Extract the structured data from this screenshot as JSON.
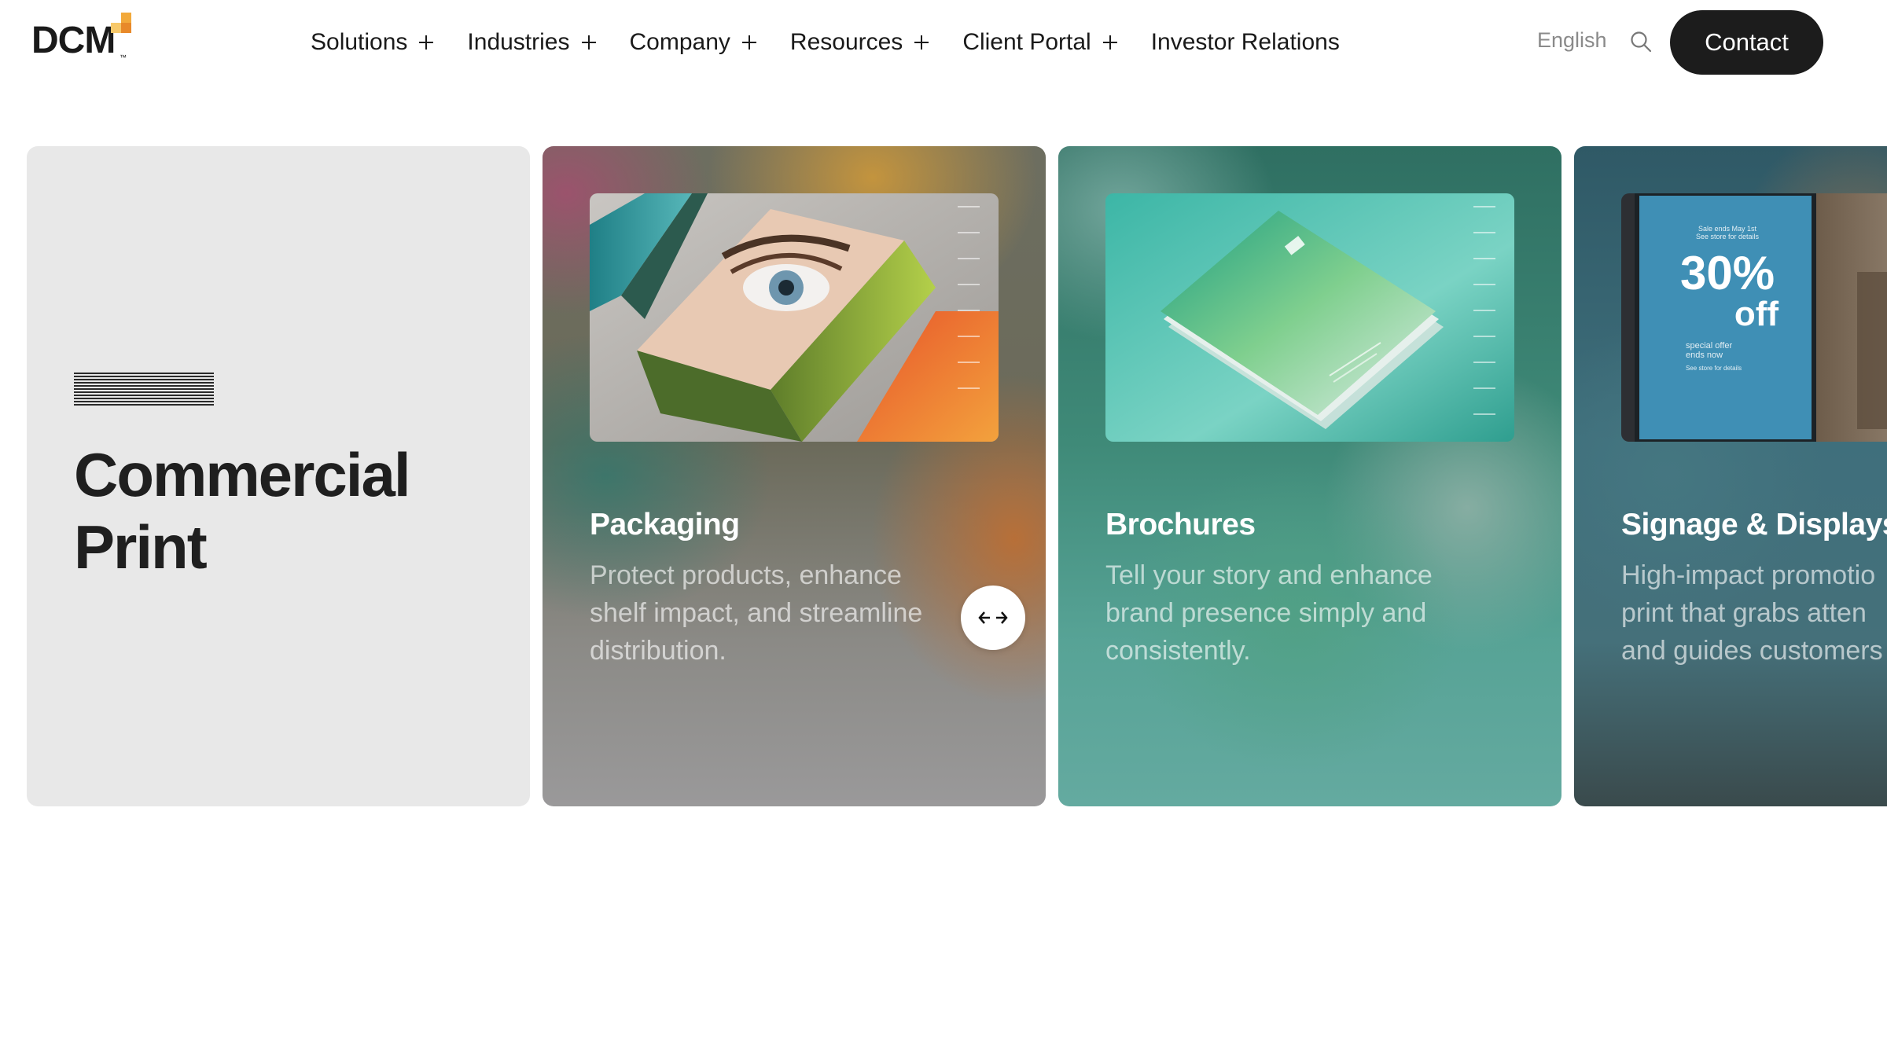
{
  "header": {
    "logo": {
      "text": "DCM",
      "trademark": "™",
      "accent_colors": [
        "#f2a93b",
        "#f7c96b",
        "#e8892a"
      ]
    },
    "nav": [
      {
        "label": "Solutions",
        "has_submenu": true
      },
      {
        "label": "Industries",
        "has_submenu": true
      },
      {
        "label": "Company",
        "has_submenu": true
      },
      {
        "label": "Resources",
        "has_submenu": true
      },
      {
        "label": "Client Portal",
        "has_submenu": true
      },
      {
        "label": "Investor Relations",
        "has_submenu": false
      }
    ],
    "language": "English",
    "search_icon": "search-icon",
    "contact_label": "Contact"
  },
  "intro_card": {
    "title": "Commercial Print",
    "background": "#e8e8e8"
  },
  "cards": [
    {
      "title": "Packaging",
      "description": "Protect products, enhance shelf impact, and streamline distribution."
    },
    {
      "title": "Brochures",
      "description": "Tell your story and enhance brand presence simply and consistently."
    },
    {
      "title": "Signage & Displays",
      "description_lines": [
        "High-impact promotio",
        "print that grabs atten",
        "and guides customers"
      ],
      "sign_image": {
        "line1": "Sale ends May 1st",
        "line2": "See store for details",
        "headline": "30%",
        "sub": "off",
        "small1": "special offer",
        "small2": "ends now",
        "small3": "See store for details"
      }
    }
  ],
  "carousel_control": {
    "icon": "drag-arrows-icon"
  }
}
